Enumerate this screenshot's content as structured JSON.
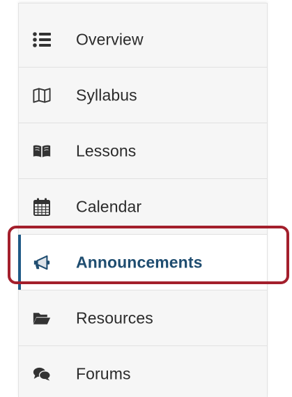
{
  "tool_menu": {
    "items": [
      {
        "label": "Overview",
        "icon": "list-icon"
      },
      {
        "label": "Syllabus",
        "icon": "map-icon"
      },
      {
        "label": "Lessons",
        "icon": "book-open-icon"
      },
      {
        "label": "Calendar",
        "icon": "calendar-icon"
      },
      {
        "label": "Announcements",
        "icon": "bullhorn-icon",
        "active": true
      },
      {
        "label": "Resources",
        "icon": "folder-open-icon"
      },
      {
        "label": "Forums",
        "icon": "comments-icon"
      }
    ]
  },
  "colors": {
    "active_accent": "#1f5a86",
    "highlight": "#a31f2c",
    "icon": "#333333"
  }
}
